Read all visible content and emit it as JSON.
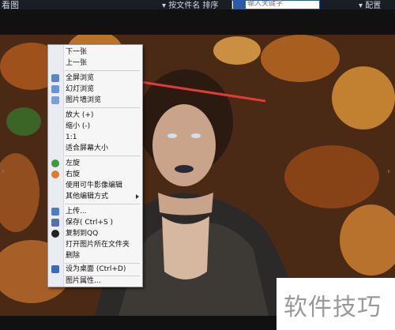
{
  "topbar": {
    "title": "看图",
    "sort_label": "▾ 按文件名 排序",
    "search_placeholder": "输入关键字",
    "settings_label": "▾ 配置"
  },
  "context_menu": {
    "items": [
      {
        "label": "下一张",
        "icon": null
      },
      {
        "label": "上一张",
        "icon": null
      },
      {
        "label": "全屏浏览",
        "icon": "fullscreen-icon"
      },
      {
        "label": "幻灯浏览",
        "icon": "slideshow-icon"
      },
      {
        "label": "图片墙浏览",
        "icon": "image-wall-icon"
      },
      {
        "label": "放大 (+)",
        "icon": null
      },
      {
        "label": "缩小 (-)",
        "icon": null
      },
      {
        "label": "1:1",
        "icon": null
      },
      {
        "label": "适合屏幕大小",
        "icon": null
      },
      {
        "label": "左旋",
        "icon": "rotate-left-icon"
      },
      {
        "label": "右旋",
        "icon": "rotate-right-icon"
      },
      {
        "label": "使用可牛影像编辑",
        "icon": null
      },
      {
        "label": "其他编辑方式",
        "icon": null,
        "submenu": true
      },
      {
        "label": "上传...",
        "icon": "upload-icon"
      },
      {
        "label": "保存( Ctrl+S )",
        "icon": "save-icon"
      },
      {
        "label": "复制到QQ",
        "icon": "qq-icon"
      },
      {
        "label": "打开图片所在文件夹",
        "icon": null
      },
      {
        "label": "删除",
        "icon": null
      },
      {
        "label": "设为桌面    (Ctrl+D)",
        "icon": "desktop-icon"
      },
      {
        "label": "图片属性...",
        "icon": null
      }
    ]
  },
  "watermark_text": "软件技巧",
  "nav": {
    "prev": "‹",
    "next": "›"
  },
  "colors": {
    "accent_arrow": "#e53935",
    "menu_bg": "#f6f6f6",
    "topbar_bg": "#1a1d22"
  }
}
